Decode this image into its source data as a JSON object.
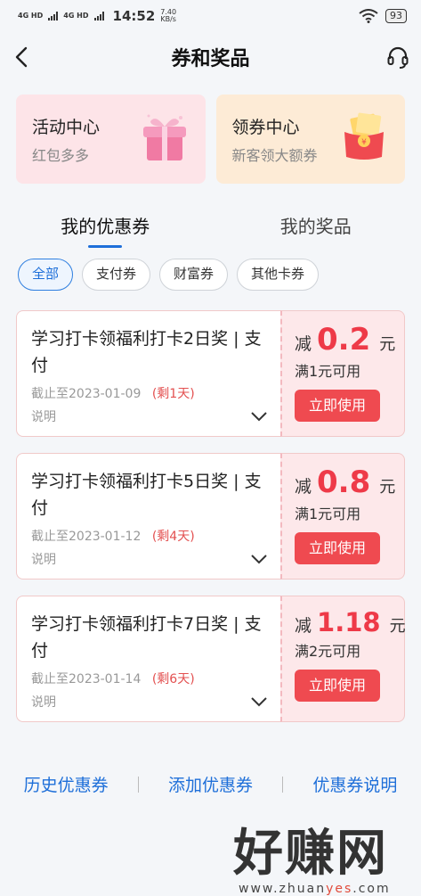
{
  "status_bar": {
    "signal1": "4G HD",
    "signal2": "4G HD",
    "time": "14:52",
    "speed_value": "7.40",
    "speed_unit": "KB/s",
    "battery": "93"
  },
  "header": {
    "title": "券和奖品",
    "back_icon": "back-arrow-icon",
    "service_icon": "headset-icon"
  },
  "promo_cards": [
    {
      "title": "活动中心",
      "subtitle": "红包多多",
      "icon": "gift-box-icon",
      "bg": "#fde4e8"
    },
    {
      "title": "领券中心",
      "subtitle": "新客领大额券",
      "icon": "red-envelope-icon",
      "bg": "#fdebd6"
    }
  ],
  "tabs": [
    {
      "label": "我的优惠券",
      "active": true
    },
    {
      "label": "我的奖品",
      "active": false
    }
  ],
  "filters": [
    {
      "label": "全部",
      "active": true
    },
    {
      "label": "支付券",
      "active": false
    },
    {
      "label": "财富券",
      "active": false
    },
    {
      "label": "其他卡券",
      "active": false
    }
  ],
  "coupons": [
    {
      "title": "学习打卡领福利打卡2日奖 | 支付",
      "expiry": "截止至2023-01-09",
      "remaining": "(剩1天)",
      "desc": "说明",
      "prefix": "减",
      "amount": "0.2",
      "unit": "元",
      "condition": "满1元可用",
      "button": "立即使用"
    },
    {
      "title": "学习打卡领福利打卡5日奖 | 支付",
      "expiry": "截止至2023-01-12",
      "remaining": "(剩4天)",
      "desc": "说明",
      "prefix": "减",
      "amount": "0.8",
      "unit": "元",
      "condition": "满1元可用",
      "button": "立即使用"
    },
    {
      "title": "学习打卡领福利打卡7日奖 | 支付",
      "expiry": "截止至2023-01-14",
      "remaining": "(剩6天)",
      "desc": "说明",
      "prefix": "减",
      "amount": "1.18",
      "unit": "元",
      "condition": "满2元可用",
      "button": "立即使用"
    }
  ],
  "bottom_links": [
    "历史优惠券",
    "添加优惠券",
    "优惠券说明"
  ],
  "watermark": {
    "text": "好赚网",
    "url_prefix": "www.zhuan",
    "url_highlight": "yes",
    "url_suffix": ".com"
  },
  "colors": {
    "accent": "#1e6fd9",
    "coupon_red": "#ee3a48",
    "button_red": "#ef4a50"
  }
}
